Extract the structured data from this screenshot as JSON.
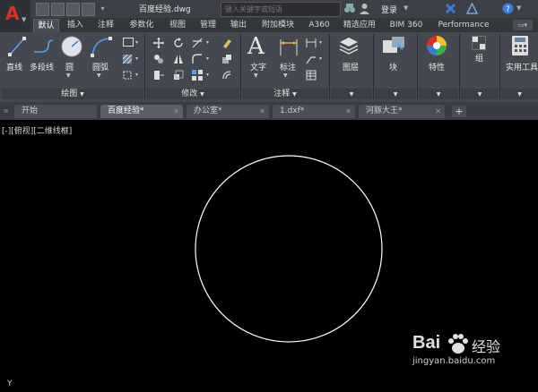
{
  "app": {
    "logo": "A",
    "title": "百度经验.dwg"
  },
  "search": {
    "placeholder": "键入关键字或短语"
  },
  "account": {
    "login_label": "登录"
  },
  "ribbon_tabs": [
    "默认",
    "插入",
    "注释",
    "参数化",
    "视图",
    "管理",
    "输出",
    "附加模块",
    "A360",
    "精选应用",
    "BIM 360",
    "Performance"
  ],
  "active_ribbon_tab": "默认",
  "draw_panel": {
    "title": "绘图",
    "tools": [
      "直线",
      "多段线",
      "圆",
      "圆弧"
    ]
  },
  "modify_panel": {
    "title": "修改"
  },
  "annotation_panel": {
    "title": "注释",
    "tools": [
      "文字",
      "标注"
    ]
  },
  "layers_panel": {
    "label": "图层"
  },
  "block_panel": {
    "label": "块"
  },
  "properties_panel": {
    "label": "特性"
  },
  "groups_panel": {
    "label": "组"
  },
  "utilities_panel": {
    "label": "实用工具"
  },
  "doc_tabs": [
    {
      "label": "开始",
      "closable": false,
      "active": false
    },
    {
      "label": "百度经验*",
      "closable": true,
      "active": true
    },
    {
      "label": "办公室*",
      "closable": true,
      "active": false
    },
    {
      "label": "1.dxf*",
      "closable": true,
      "active": false
    },
    {
      "label": "河豚大王*",
      "closable": true,
      "active": false
    }
  ],
  "doc_tab_add": "+",
  "viewport": {
    "label": "[-][俯视][二维线框]",
    "ucs_axis": "Y"
  },
  "watermark": {
    "brand": "Bai",
    "brand2": "经验",
    "url": "jingyan.baidu.com"
  },
  "colors": {
    "accent_red": "#d8312b",
    "ribbon_bg": "#45484e",
    "canvas": "#000000",
    "circle": "#ffffff"
  }
}
